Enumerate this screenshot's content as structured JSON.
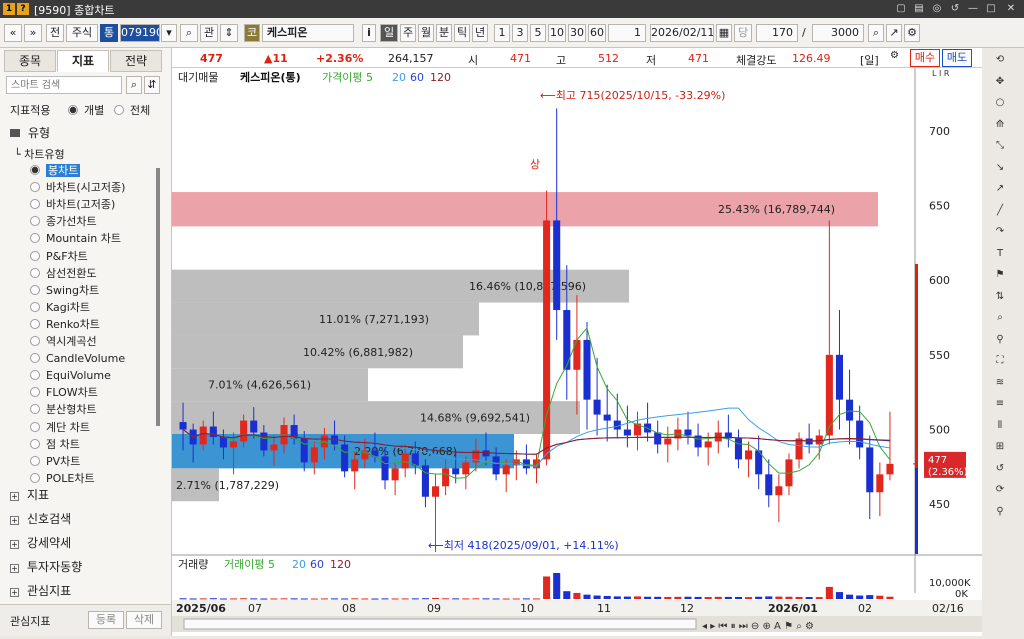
{
  "window": {
    "title": "[9590] 종합차트",
    "icon_a": "1",
    "icon_b": "?",
    "controls": [
      "▢",
      "▤",
      "◎",
      "↺",
      "—",
      "□",
      "✕"
    ]
  },
  "toolbar": {
    "nav": [
      "«",
      "»"
    ],
    "type_a": "전",
    "type_b": "주식",
    "exch": "통",
    "code": "079190",
    "code_drop": "▾",
    "search": "⌕",
    "rel": "관",
    "arrows": "⇕",
    "badge": "코",
    "name": "케스피온",
    "info": "i",
    "periods": [
      "일",
      "주",
      "월",
      "분",
      "틱",
      "년"
    ],
    "counts": [
      "1",
      "3",
      "5",
      "10",
      "30",
      "60"
    ],
    "unit_drop": "1",
    "date": "2026/02/11",
    "cal": "▦",
    "dang": "당",
    "count": "170",
    "slash": "/",
    "total": "3000",
    "icons": [
      "⌕",
      "↗",
      "⚙"
    ]
  },
  "left": {
    "tabs": [
      "종목",
      "지표",
      "전략"
    ],
    "search_placeholder": "스마트 검색",
    "search_btns": [
      "⌕",
      "⇵"
    ],
    "apply_label": "지표적용",
    "apply_opts": [
      "개별",
      "전체"
    ],
    "type_group": "유형",
    "chart_type_label": "차트유형",
    "chart_types": [
      "봉차트",
      "바차트(시고저종)",
      "바차트(고저종)",
      "종가선차트",
      "Mountain 차트",
      "P&F차트",
      "삼선전환도",
      "Swing차트",
      "Kagi차트",
      "Renko차트",
      "역시계곡선",
      "CandleVolume",
      "EquiVolume",
      "FLOW차트",
      "분산형차트",
      "계단 차트",
      "점 차트",
      "PV차트",
      "POLE차트"
    ],
    "groups": [
      "지표",
      "신호검색",
      "강세약세",
      "투자자동향",
      "관심지표"
    ],
    "bottom_label": "관심지표",
    "bottom_btns": [
      "등록",
      "삭제"
    ]
  },
  "quote": {
    "price": "477",
    "change": "▲11",
    "pct": "+2.36%",
    "volume": "264,157",
    "open_l": "시",
    "open": "471",
    "high_l": "고",
    "high": "512",
    "low_l": "저",
    "low": "471",
    "str_l": "체결강도",
    "str": "126.49",
    "period": "[일]",
    "buy": "매수",
    "sell": "매도"
  },
  "chart": {
    "legend_a": "대기매물",
    "legend_name": "케스피온(통)",
    "legend_ma": "가격이평 5",
    "ma": [
      "20",
      "60",
      "120"
    ],
    "vol_title": "거래량",
    "vol_ma": "거래이평 5",
    "max_label": "⟵최고 715(2025/10/15, -33.29%)",
    "min_label": "⟵최저 418(2025/09/01, +14.11%)",
    "signal": "상",
    "cur_price": "477",
    "cur_pct": "(2.36%)",
    "vol_ticks": [
      "10,000K",
      "0K"
    ],
    "date_end": "02/16",
    "lir": "L I R",
    "colors": {
      "up": "#e0281e",
      "down": "#1a2fd0",
      "band": "#b3b3b3",
      "band_hot": "#e8939a",
      "band_cur": "#2f8fd0",
      "ma5": "#3aa832",
      "ma20": "#3aa0e0",
      "ma60": "#2b3fd6",
      "ma120": "#8b1f2a"
    }
  },
  "chart_data": {
    "type": "candlestick",
    "ylim": [
      418,
      730
    ],
    "yticks": [
      450,
      500,
      550,
      600,
      650,
      700
    ],
    "xticks": [
      "2025/06",
      "07",
      "08",
      "09",
      "10",
      "11",
      "12",
      "2026/01",
      "02"
    ],
    "volume_profile": [
      {
        "label": "25.43% (16,789,744)",
        "from": 636,
        "to": 659
      },
      {
        "label": "16.46% (10,867,596)",
        "from": 585,
        "to": 607
      },
      {
        "label": "11.01% (7,271,193)",
        "from": 563,
        "to": 585
      },
      {
        "label": "10.42% (6,881,982)",
        "from": 541,
        "to": 563
      },
      {
        "label": "7.01% (4,626,561)",
        "from": 519,
        "to": 541
      },
      {
        "label": "14.68% (9,692,541)",
        "from": 497,
        "to": 519
      },
      {
        "label": "2.29% (6,770,668)",
        "from": 474,
        "to": 497
      },
      {
        "label": "2.71% (1,787,229)",
        "from": 452,
        "to": 474
      }
    ],
    "ohlc": [
      [
        505,
        518,
        486,
        500
      ],
      [
        500,
        504,
        478,
        490
      ],
      [
        490,
        506,
        486,
        502
      ],
      [
        502,
        512,
        490,
        495
      ],
      [
        495,
        500,
        480,
        488
      ],
      [
        488,
        498,
        470,
        492
      ],
      [
        492,
        510,
        488,
        506
      ],
      [
        506,
        515,
        494,
        498
      ],
      [
        498,
        503,
        482,
        486
      ],
      [
        486,
        496,
        476,
        490
      ],
      [
        490,
        508,
        484,
        503
      ],
      [
        503,
        510,
        490,
        494
      ],
      [
        494,
        499,
        472,
        478
      ],
      [
        478,
        492,
        470,
        488
      ],
      [
        488,
        501,
        480,
        496
      ],
      [
        496,
        506,
        486,
        490
      ],
      [
        490,
        496,
        468,
        472
      ],
      [
        472,
        485,
        460,
        480
      ],
      [
        480,
        494,
        474,
        486
      ],
      [
        486,
        498,
        478,
        482
      ],
      [
        482,
        488,
        460,
        466
      ],
      [
        466,
        478,
        456,
        474
      ],
      [
        474,
        490,
        468,
        484
      ],
      [
        484,
        492,
        470,
        476
      ],
      [
        476,
        480,
        448,
        455
      ],
      [
        455,
        470,
        418,
        462
      ],
      [
        462,
        480,
        456,
        474
      ],
      [
        474,
        486,
        464,
        470
      ],
      [
        470,
        482,
        460,
        478
      ],
      [
        478,
        494,
        472,
        486
      ],
      [
        486,
        498,
        476,
        482
      ],
      [
        482,
        488,
        466,
        470
      ],
      [
        470,
        480,
        458,
        476
      ],
      [
        476,
        486,
        466,
        480
      ],
      [
        480,
        490,
        470,
        474
      ],
      [
        474,
        484,
        464,
        480
      ],
      [
        480,
        660,
        476,
        640
      ],
      [
        640,
        715,
        560,
        580
      ],
      [
        580,
        610,
        520,
        540
      ],
      [
        540,
        590,
        510,
        560
      ],
      [
        560,
        572,
        500,
        520
      ],
      [
        520,
        548,
        496,
        510
      ],
      [
        510,
        530,
        492,
        506
      ],
      [
        506,
        524,
        494,
        500
      ],
      [
        500,
        516,
        488,
        496
      ],
      [
        496,
        512,
        486,
        504
      ],
      [
        504,
        518,
        492,
        498
      ],
      [
        498,
        506,
        484,
        490
      ],
      [
        490,
        502,
        478,
        494
      ],
      [
        494,
        508,
        486,
        500
      ],
      [
        500,
        512,
        490,
        496
      ],
      [
        496,
        504,
        482,
        488
      ],
      [
        488,
        498,
        476,
        492
      ],
      [
        492,
        506,
        484,
        498
      ],
      [
        498,
        510,
        488,
        494
      ],
      [
        494,
        500,
        474,
        480
      ],
      [
        480,
        492,
        468,
        486
      ],
      [
        486,
        496,
        460,
        470
      ],
      [
        470,
        480,
        448,
        456
      ],
      [
        456,
        470,
        438,
        462
      ],
      [
        462,
        484,
        456,
        480
      ],
      [
        480,
        498,
        474,
        494
      ],
      [
        494,
        504,
        484,
        490
      ],
      [
        490,
        500,
        480,
        496
      ],
      [
        496,
        640,
        490,
        550
      ],
      [
        550,
        580,
        500,
        520
      ],
      [
        520,
        540,
        490,
        506
      ],
      [
        506,
        516,
        480,
        488
      ],
      [
        488,
        496,
        440,
        458
      ],
      [
        458,
        478,
        442,
        470
      ],
      [
        470,
        512,
        466,
        477
      ]
    ],
    "volume": [
      80,
      60,
      70,
      90,
      60,
      65,
      85,
      70,
      55,
      60,
      75,
      70,
      60,
      55,
      65,
      70,
      60,
      80,
      60,
      55,
      70,
      60,
      65,
      70,
      90,
      120,
      80,
      70,
      65,
      75,
      70,
      60,
      55,
      60,
      70,
      65,
      2600,
      3000,
      900,
      700,
      500,
      400,
      350,
      300,
      280,
      300,
      260,
      250,
      240,
      250,
      260,
      240,
      230,
      250,
      240,
      230,
      220,
      260,
      300,
      280,
      260,
      240,
      230,
      220,
      1400,
      800,
      500,
      400,
      450,
      380,
      264
    ]
  }
}
